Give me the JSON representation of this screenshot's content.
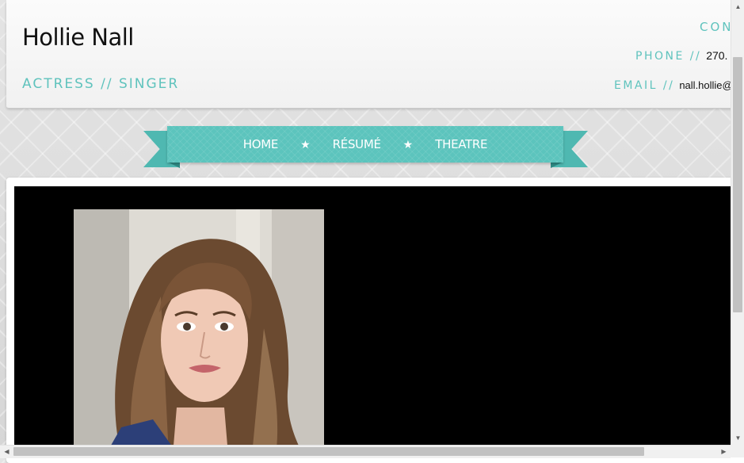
{
  "header": {
    "site_name": "Hollie Nall",
    "tagline": "ACTRESS // SINGER",
    "contact_heading": "CONT",
    "phone_label": "PHONE //",
    "phone_value": "270.",
    "email_label": "EMAIL //",
    "email_value": "nall.hollie@"
  },
  "nav": {
    "items": [
      "HOME",
      "RÉSUMÉ",
      "THEATRE"
    ],
    "separator": "★",
    "color": "#5cc4bd"
  },
  "slideshow": {
    "background": "#000000",
    "image": "headshot-photo"
  },
  "colors": {
    "accent": "#5fc3bd",
    "text": "#111111"
  }
}
